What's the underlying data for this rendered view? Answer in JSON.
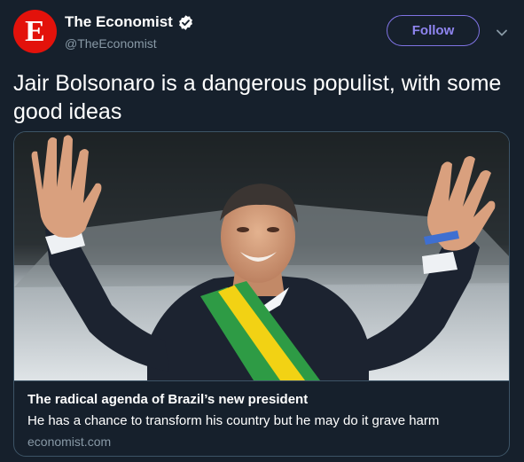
{
  "account": {
    "display_name": "The Economist",
    "handle": "@TheEconomist",
    "avatar_letter": "E",
    "verified": true
  },
  "actions": {
    "follow_label": "Follow",
    "menu_icon": "chevron-down-icon"
  },
  "tweet": {
    "text": "Jair Bolsonaro is a dangerous populist, with some good ideas"
  },
  "link_card": {
    "image": "photo-of-man-with-raised-arms-wearing-green-yellow-sash",
    "title": "The radical agenda of Brazil’s new president",
    "description": "He has a chance to transform his country but he may do it grave harm",
    "domain": "economist.com"
  },
  "colors": {
    "background": "#16202c",
    "brand_red": "#e3120b",
    "follow_accent": "#8f85f0",
    "muted_text": "#8899a6",
    "border": "#3d5466"
  }
}
